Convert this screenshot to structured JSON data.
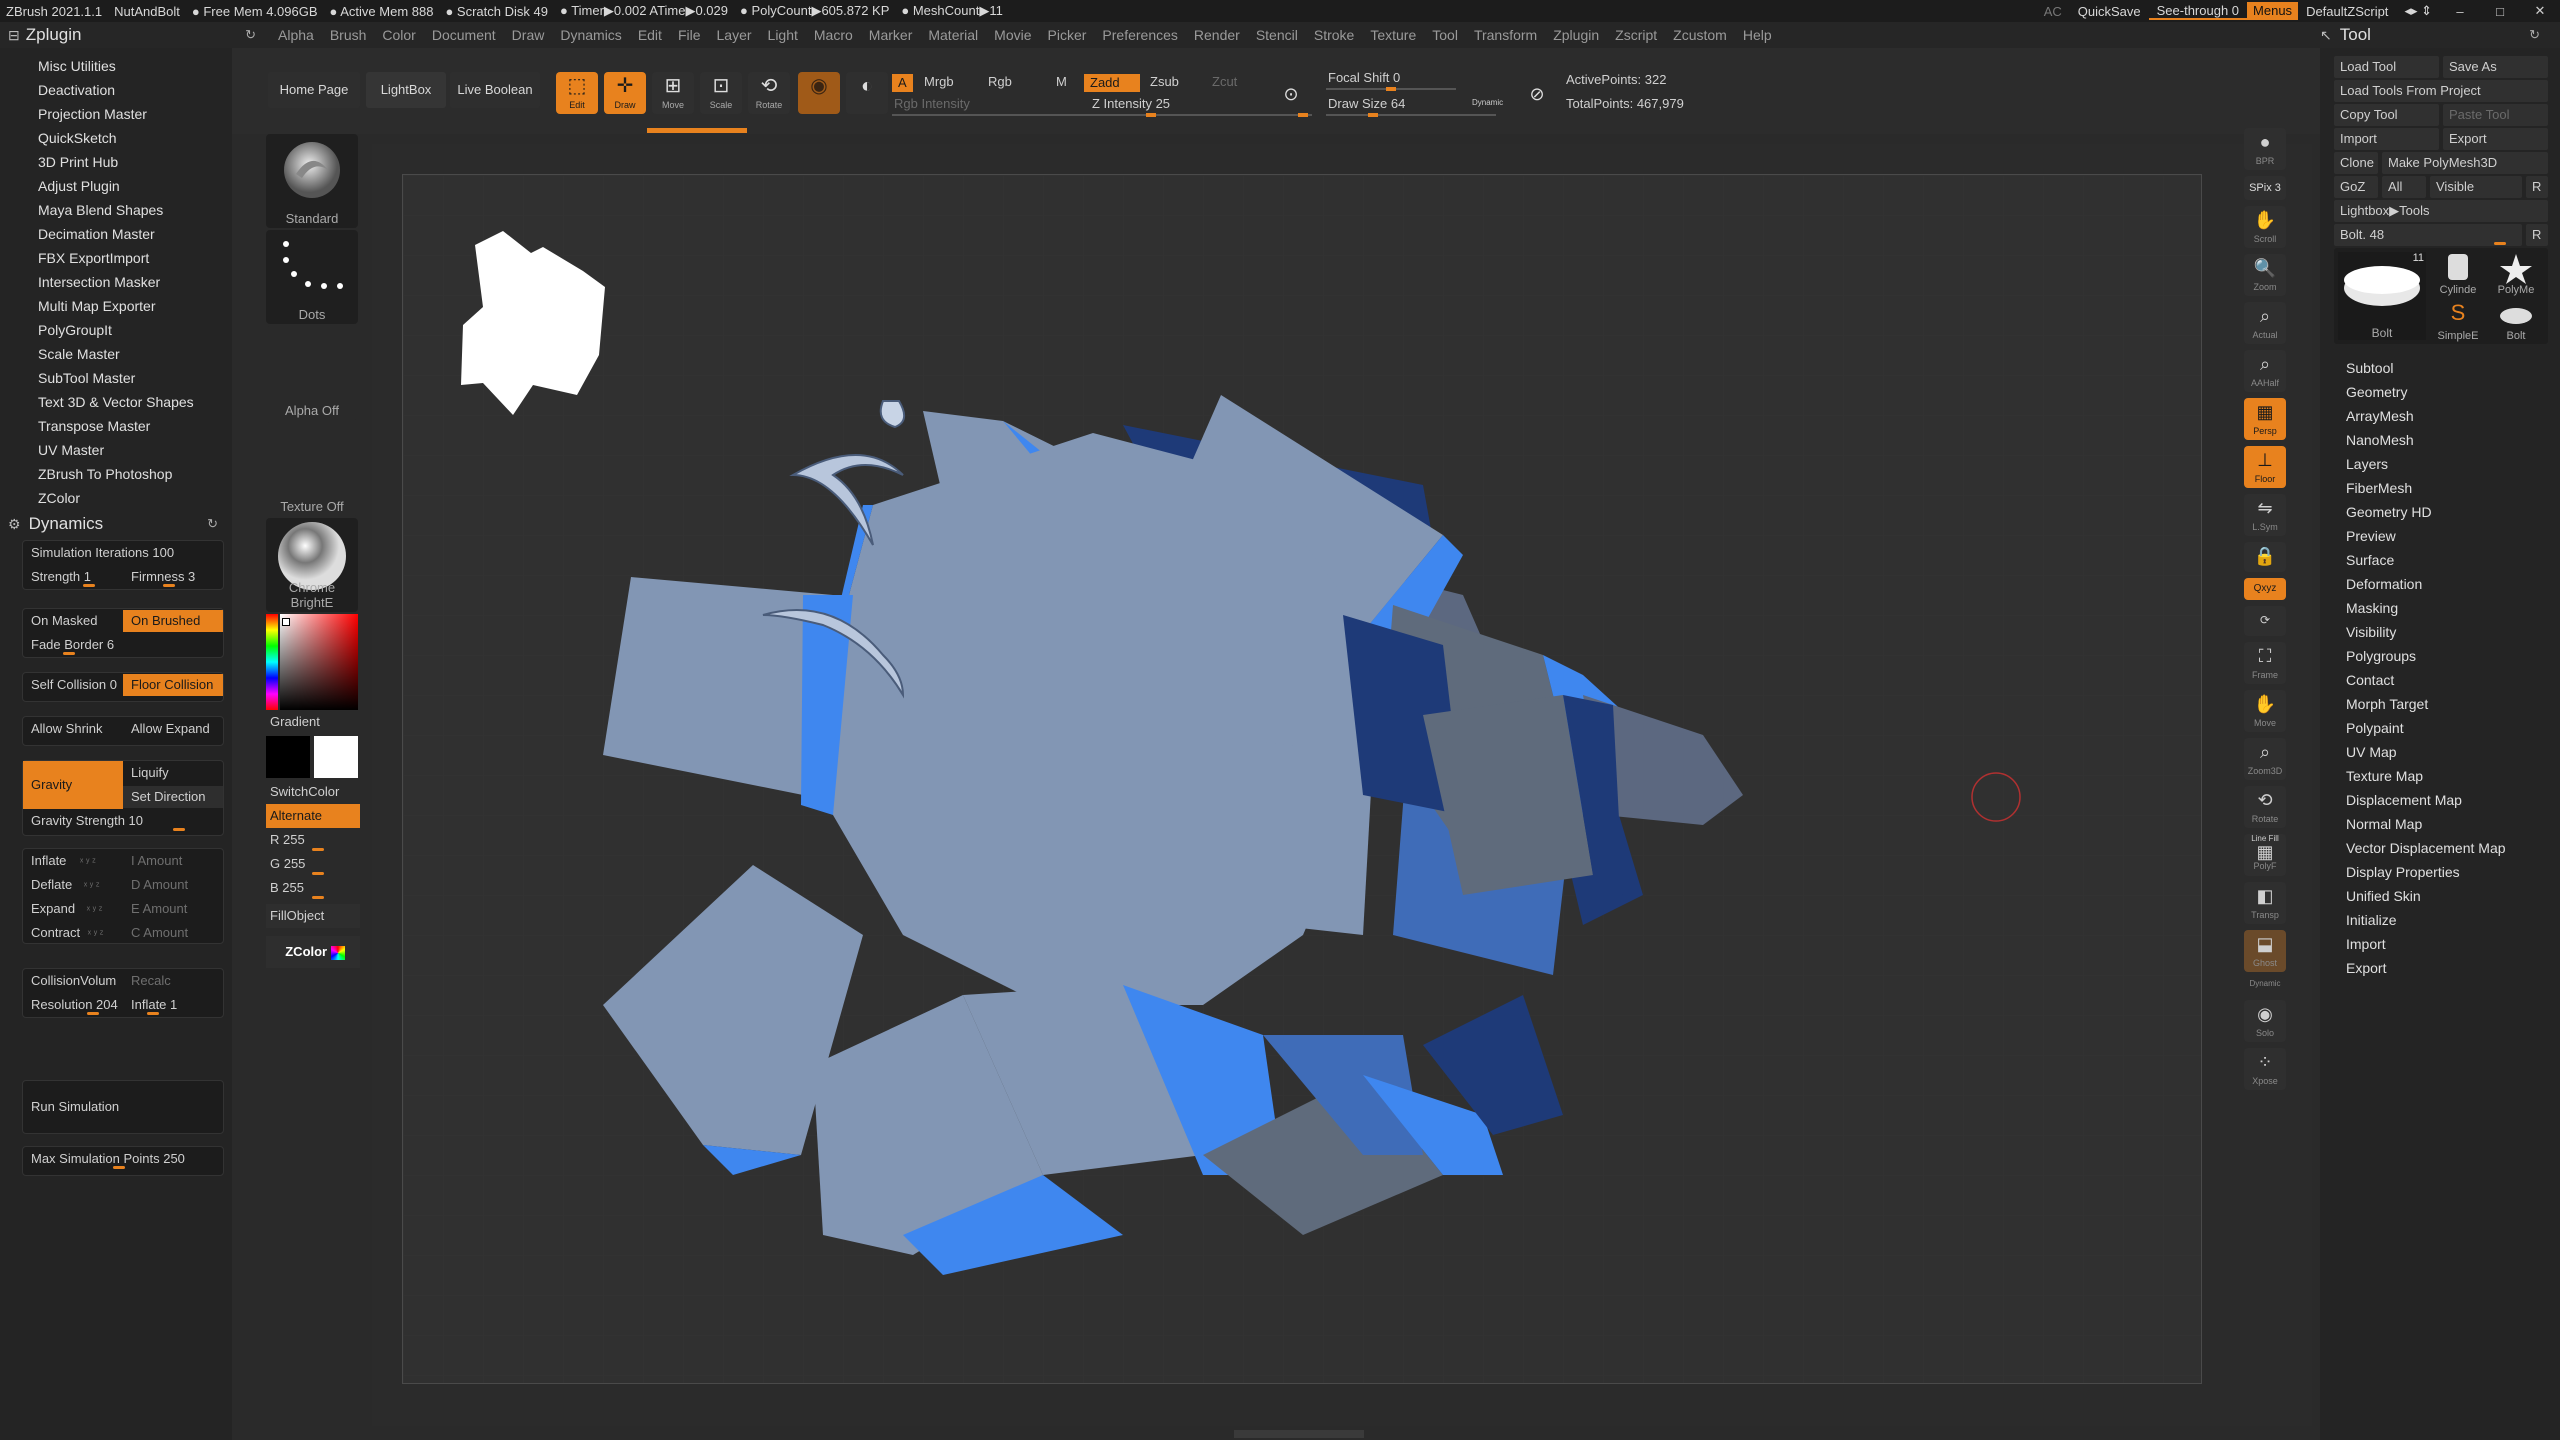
{
  "titlebar": {
    "app": "ZBrush 2021.1.1",
    "project": "NutAndBolt",
    "stats": [
      "● Free Mem 4.096GB",
      "● Active Mem 888",
      "● Scratch Disk 49",
      "● Timer▶0.002 ATime▶0.029",
      "● PolyCount▶605.872 KP",
      "● MeshCount▶11"
    ],
    "ac": "AC",
    "quicksave": "QuickSave",
    "seethrough": "See-through  0",
    "menus": "Menus",
    "script": "DefaultZScript",
    "win_min": "–",
    "win_max": "□",
    "win_close": "✕"
  },
  "menubar": {
    "left_title": "Zplugin",
    "items": [
      "Alpha",
      "Brush",
      "Color",
      "Document",
      "Draw",
      "Dynamics",
      "Edit",
      "File",
      "Layer",
      "Light",
      "Macro",
      "Marker",
      "Material",
      "Movie",
      "Picker",
      "Preferences",
      "Render",
      "Stencil",
      "Stroke",
      "Texture",
      "Tool",
      "Transform",
      "Zplugin",
      "Zscript",
      "Zcustom",
      "Help"
    ],
    "right_title": "Tool"
  },
  "zplugin": {
    "items": [
      "Misc Utilities",
      "Deactivation",
      "Projection Master",
      "QuickSketch",
      "3D Print Hub",
      "Adjust Plugin",
      "Maya Blend Shapes",
      "Decimation Master",
      "FBX ExportImport",
      "Intersection Masker",
      "Multi Map Exporter",
      "PolyGroupIt",
      "Scale Master",
      "SubTool Master",
      "Text 3D & Vector Shapes",
      "Transpose Master",
      "UV Master",
      "ZBrush To Photoshop",
      "ZColor"
    ]
  },
  "dynamics": {
    "title": "Dynamics",
    "sim_iterations": "Simulation Iterations 100",
    "strength": "Strength 1",
    "firmness": "Firmness 3",
    "on_masked": "On Masked",
    "on_brushed": "On Brushed",
    "fade_border": "Fade Border 6",
    "self_collision": "Self Collision 0",
    "floor_collision": "Floor Collision",
    "allow_shrink": "Allow Shrink",
    "allow_expand": "Allow Expand",
    "gravity": "Gravity",
    "liquify": "Liquify",
    "set_direction": "Set Direction",
    "gravity_strength": "Gravity Strength 10",
    "inflate": "Inflate",
    "deflate": "Deflate",
    "expand": "Expand",
    "contract": "Contract",
    "i_amount": "I Amount",
    "d_amount": "D Amount",
    "e_amount": "E Amount",
    "c_amount": "C Amount",
    "xyz": "ˣ ʸ ᶻ",
    "collision_volume": "CollisionVolum",
    "recalc": "Recalc",
    "resolution": "Resolution 204",
    "inflate1": "Inflate 1",
    "run_simulation": "Run Simulation",
    "max_sim_points": "Max Simulation Points 250"
  },
  "shelf": {
    "home": "Home Page",
    "lightbox": "LightBox",
    "live_boolean": "Live Boolean",
    "edit": "Edit",
    "draw": "Draw",
    "move": "Move",
    "scale": "Scale",
    "rotate": "Rotate",
    "a": "A",
    "mrgb": "Mrgb",
    "rgb": "Rgb",
    "m": "M",
    "rgb_intensity": "Rgb Intensity",
    "zadd": "Zadd",
    "zsub": "Zsub",
    "zcut": "Zcut",
    "z_intensity": "Z Intensity 25",
    "focal_shift": "Focal Shift 0",
    "draw_size": "Draw Size 64",
    "dynamic": "Dynamic",
    "active_points": "ActivePoints: 322",
    "total_points": "TotalPoints: 467,979"
  },
  "toolcol": {
    "standard": "Standard",
    "dots": "Dots",
    "alpha_off": "Alpha Off",
    "texture_off": "Texture Off",
    "material": "Chrome BrightE",
    "gradient": "Gradient",
    "switchcolor": "SwitchColor",
    "alternate": "Alternate",
    "r": "R 255",
    "g": "G 255",
    "b": "B 255",
    "fillobject": "FillObject",
    "zcolor": "ZColor"
  },
  "righttools": {
    "bpr": "BPR",
    "spix": "SPix 3",
    "scroll": "Scroll",
    "zoom": "Zoom",
    "actual": "Actual",
    "aahalf": "AAHalf",
    "persp": "Persp",
    "floor": "Floor",
    "lsym": "L.Sym",
    "lock": "",
    "qxyz": "Qxyz",
    "frame": "Frame",
    "move": "Move",
    "zoom3d": "Zoom3D",
    "rotate": "Rotate",
    "linefill": "Line Fill",
    "polyf": "PolyF",
    "transp": "Transp",
    "ghost": "Ghost",
    "dynamic": "Dynamic",
    "solo": "Solo",
    "xpose": "Xpose"
  },
  "toolpanel": {
    "load_tool": "Load Tool",
    "save_as": "Save As",
    "load_from_project": "Load Tools From Project",
    "copy_tool": "Copy Tool",
    "paste_tool": "Paste Tool",
    "import": "Import",
    "export": "Export",
    "clone": "Clone",
    "make_polymesh": "Make PolyMesh3D",
    "goz": "GoZ",
    "all": "All",
    "visible": "Visible",
    "r": "R",
    "lightbox_tools": "Lightbox▶Tools",
    "bolt_slider": "Bolt. 48",
    "thumb_count": "11",
    "thumbs": [
      "Bolt",
      "Cylinde",
      "PolyMe",
      "SimpleE",
      "Bolt"
    ],
    "sections": [
      "Subtool",
      "Geometry",
      "ArrayMesh",
      "NanoMesh",
      "Layers",
      "FiberMesh",
      "Geometry HD",
      "Preview",
      "Surface",
      "Deformation",
      "Masking",
      "Visibility",
      "Polygroups",
      "Contact",
      "Morph Target",
      "Polypaint",
      "UV Map",
      "Texture Map",
      "Displacement Map",
      "Normal Map",
      "Vector Displacement Map",
      "Display Properties",
      "Unified Skin",
      "Initialize",
      "Import",
      "Export"
    ]
  },
  "colors": {
    "accent": "#e8821e",
    "mesh_face": "#8296b4",
    "mesh_bright": "#3f87ef",
    "mesh_dark": "#1e3a78",
    "mesh_grey": "#5f6b7c"
  }
}
